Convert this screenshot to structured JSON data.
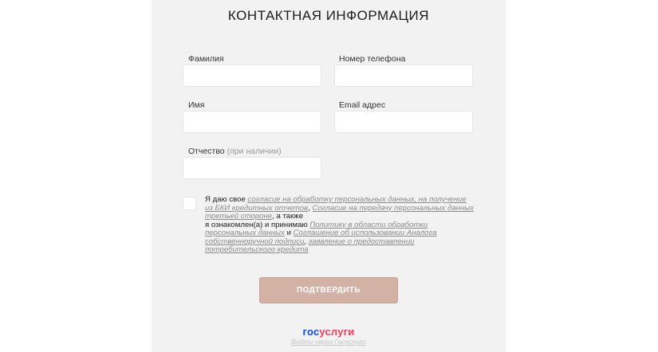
{
  "form": {
    "title": "КОНТАКТНАЯ ИНФОРМАЦИЯ",
    "fields": {
      "last_name": {
        "label": "Фамилия",
        "value": ""
      },
      "phone": {
        "label": "Номер телефона",
        "value": ""
      },
      "first_name": {
        "label": "Имя",
        "value": ""
      },
      "email": {
        "label": "Email адрес",
        "value": ""
      },
      "patronymic": {
        "label": "Отчество",
        "label_note": "(при наличии)",
        "value": ""
      }
    },
    "consent": {
      "checked": false,
      "t1": "Я даю свое ",
      "l1": "согласие на обработку персональных данных, на получение из БКИ кредитных отчетов",
      "t2": ", ",
      "l2": "Согласие на передачу персональных данных третьей стороне",
      "t3": ", а также",
      "t4": "я ознакомлен(а) и принимаю ",
      "l3": "Политику в области обработки персональных данных",
      "t5": " и ",
      "l4": "Соглашение об использовании Аналога собственноручной подписи",
      "t6": ", ",
      "l5": "заявление о предоставлении потребительского кредита"
    },
    "submit_label": "ПОДТВЕРДИТЬ"
  },
  "gosuslugi": {
    "logo_part1": "гос",
    "logo_part2": "услуги",
    "link": "Войти через Госуслуги"
  },
  "colors": {
    "panel": "#f2f2f2",
    "button": "#d4b1a5",
    "gos_blue": "#0d4cd3",
    "gos_red": "#ee3f58"
  }
}
